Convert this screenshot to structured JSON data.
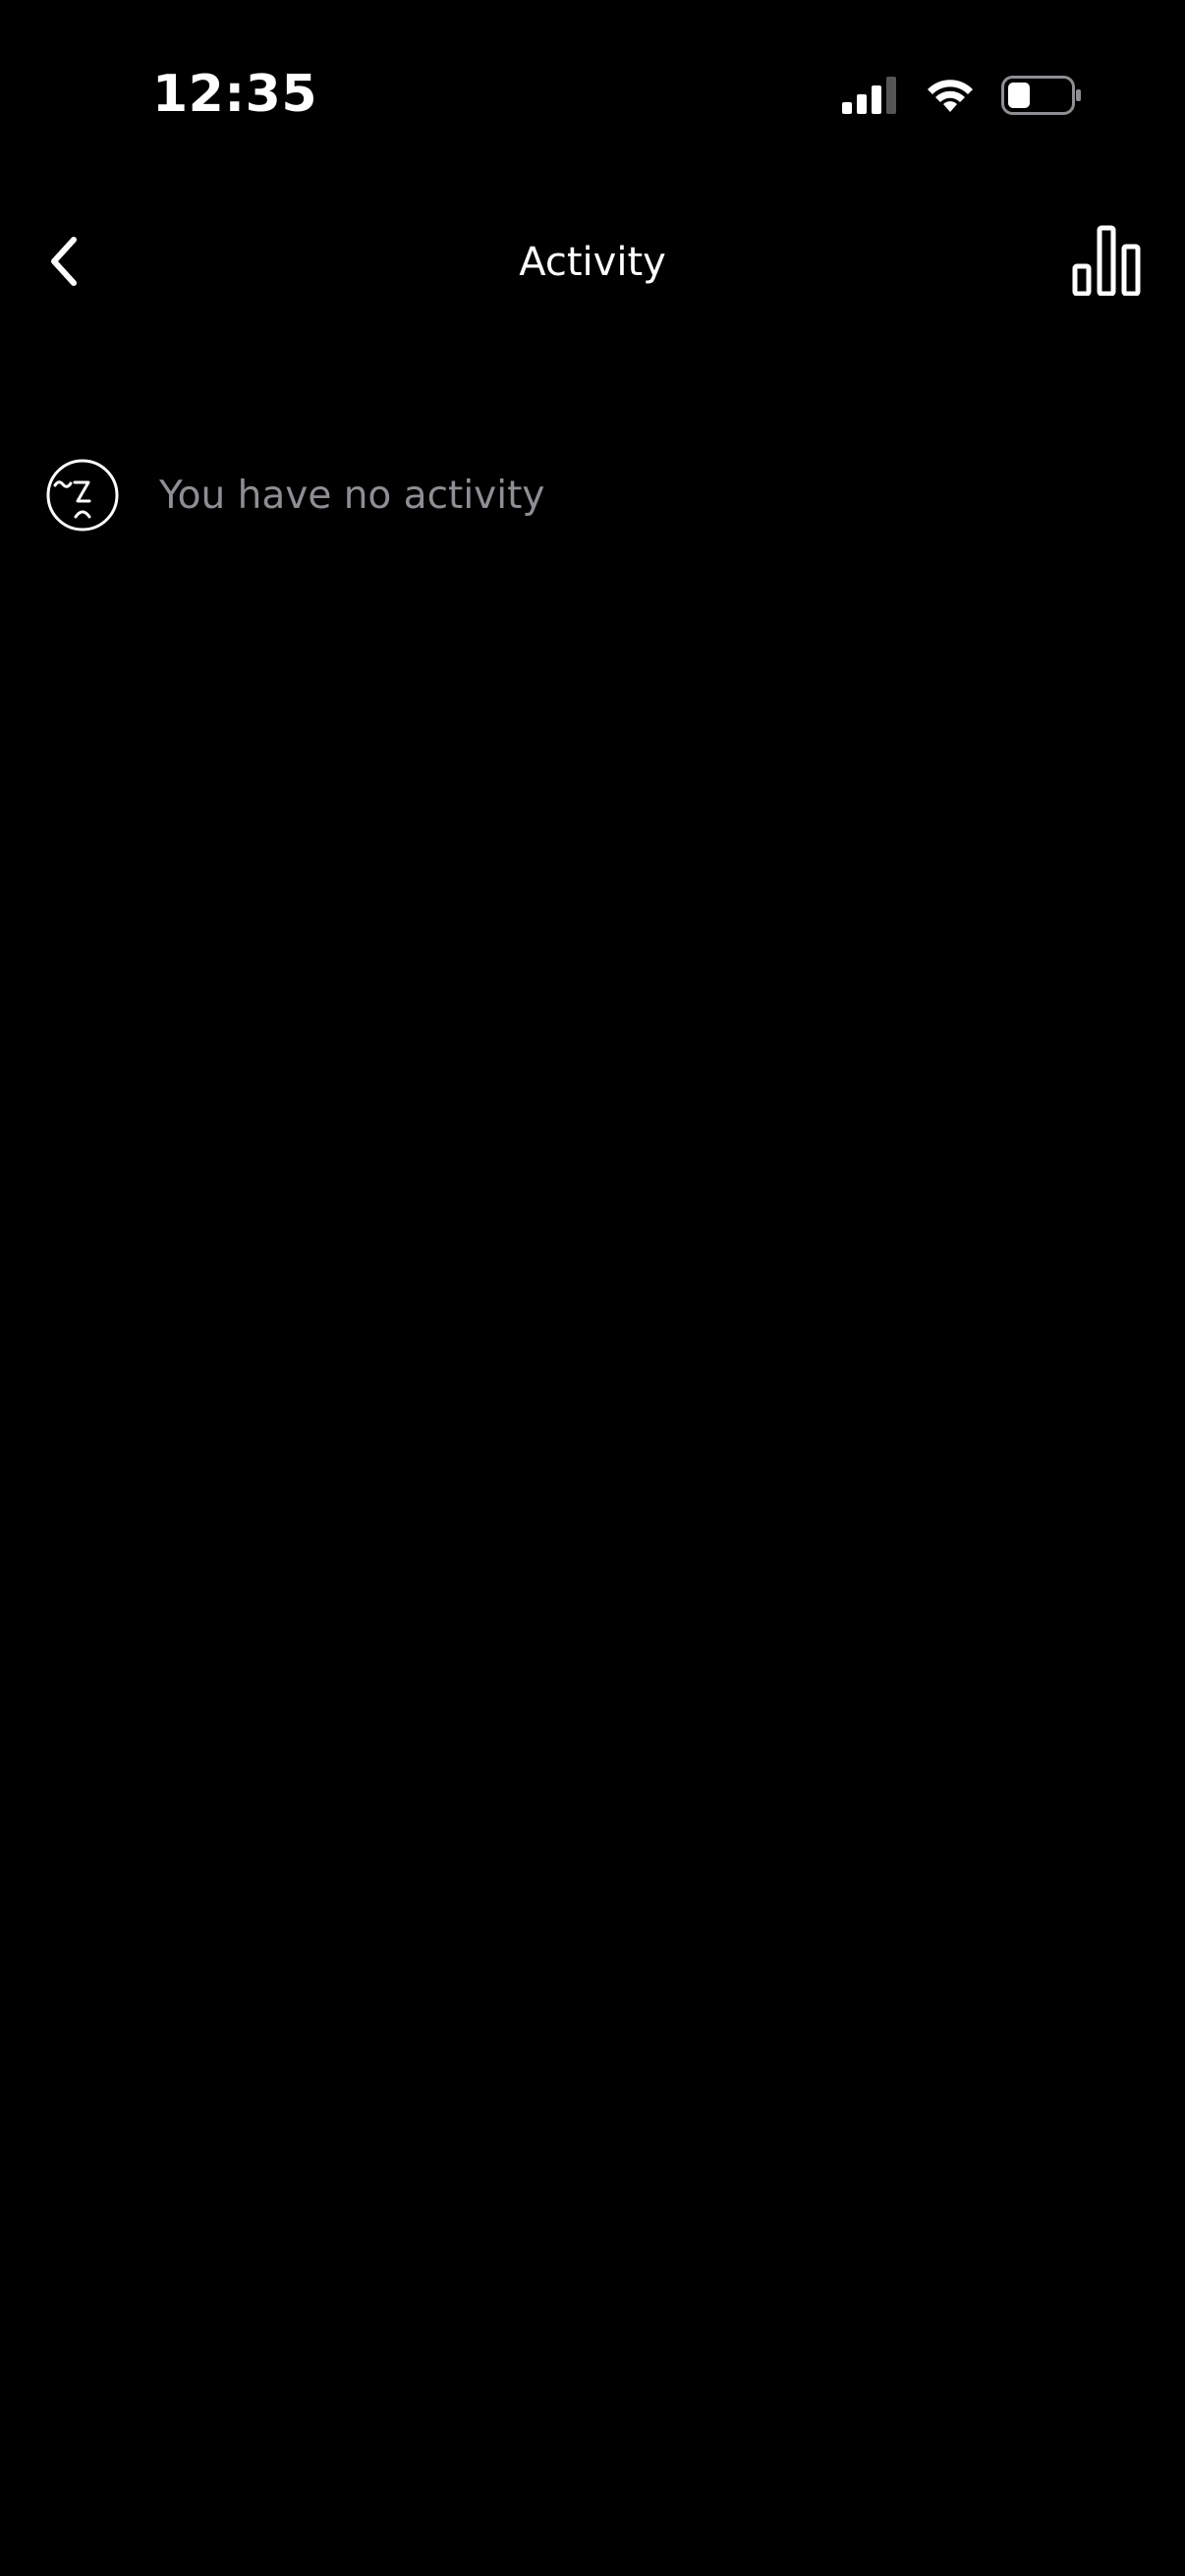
{
  "status_bar": {
    "time": "12:35",
    "icons": [
      "signal-icon",
      "wifi-icon",
      "battery-icon"
    ]
  },
  "nav": {
    "title": "Activity",
    "back_icon": "chevron-left-icon",
    "right_icon": "bar-chart-icon"
  },
  "empty_state": {
    "icon": "sad-face-icon",
    "message": "You have no activity"
  },
  "colors": {
    "background": "#000000",
    "primary_text": "#ffffff",
    "secondary_text": "#8e8e93"
  }
}
